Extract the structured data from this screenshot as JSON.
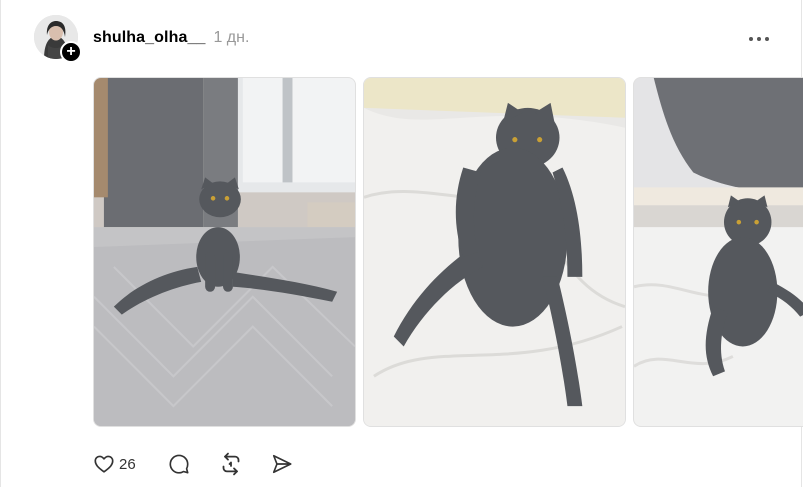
{
  "post": {
    "username": "shulha_olha__",
    "time": "1 дн.",
    "follow_icon": "plus-icon",
    "more_icon": "more-horizontal-icon",
    "images": [
      {
        "alt": "grey scottish fold cat sitting on bed by window"
      },
      {
        "alt": "grey scottish fold cat sitting on white sheets"
      },
      {
        "alt": "grey scottish fold cat sitting on bed"
      }
    ],
    "actions": {
      "like_icon": "heart-icon",
      "like_count": "26",
      "comment_icon": "comment-icon",
      "repost_icon": "repost-icon",
      "share_icon": "send-icon"
    },
    "colors": {
      "text": "#000000",
      "muted": "#999999",
      "cat": "#5a5d63"
    }
  }
}
